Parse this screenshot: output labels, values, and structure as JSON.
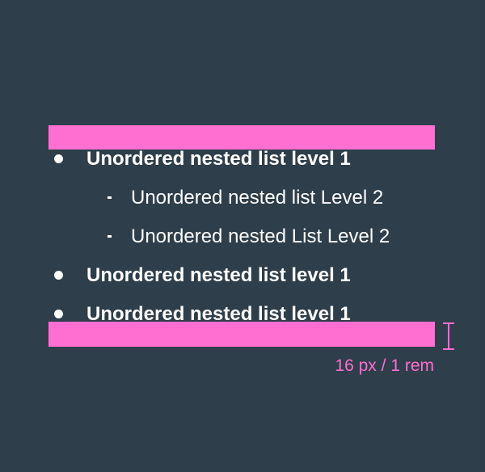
{
  "list": {
    "items": [
      {
        "level": 1,
        "text": "Unordered nested list level  1"
      },
      {
        "level": 2,
        "text": "Unordered nested list Level 2"
      },
      {
        "level": 2,
        "text": "Unordered nested List Level 2"
      },
      {
        "level": 1,
        "text": "Unordered nested list level 1"
      },
      {
        "level": 1,
        "text": "Unordered nested list level 1"
      }
    ]
  },
  "spacing": {
    "label": "16 px / 1 rem"
  },
  "colors": {
    "background": "#2e3e4a",
    "spacing_highlight": "#ff6ed1",
    "text": "#ffffff"
  }
}
